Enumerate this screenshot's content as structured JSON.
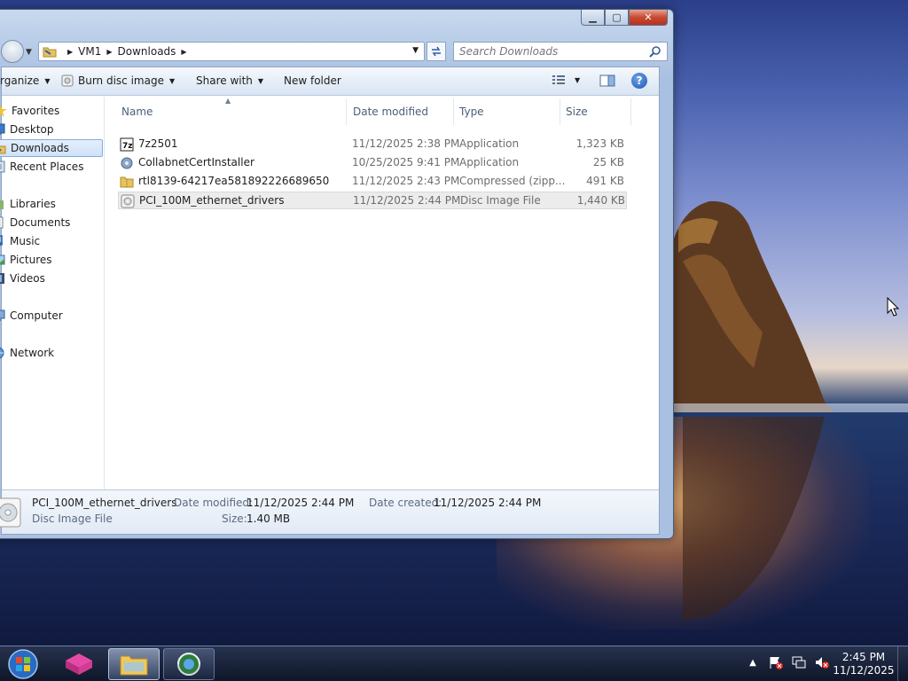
{
  "window": {
    "caption_buttons": {
      "minimize": "▁",
      "maximize": "▢",
      "close": "✕"
    }
  },
  "address_bar": {
    "crumbs": [
      "VM1",
      "Downloads"
    ],
    "search_placeholder": "Search Downloads"
  },
  "toolbar": {
    "organize": "rganize",
    "burn": "Burn disc image",
    "share": "Share with",
    "new_folder": "New folder"
  },
  "nav_pane": {
    "favorites": "Favorites",
    "desktop": "Desktop",
    "downloads": "Downloads",
    "recent": "Recent Places",
    "libraries": "Libraries",
    "documents": "Documents",
    "music": "Music",
    "pictures": "Pictures",
    "videos": "Videos",
    "computer": "Computer",
    "network": "Network"
  },
  "columns": {
    "name": "Name",
    "date": "Date modified",
    "type": "Type",
    "size": "Size"
  },
  "files": [
    {
      "name": "7z2501",
      "date": "11/12/2025 2:38 PM",
      "type": "Application",
      "size": "1,323 KB",
      "icon": "7zip-icon"
    },
    {
      "name": "CollabnetCertInstaller",
      "date": "10/25/2025 9:41 PM",
      "type": "Application",
      "size": "25 KB",
      "icon": "installer-icon"
    },
    {
      "name": "rtl8139-64217ea581892226689650",
      "date": "11/12/2025 2:43 PM",
      "type": "Compressed (zipp...",
      "size": "491 KB",
      "icon": "zip-folder-icon"
    },
    {
      "name": "PCI_100M_ethernet_drivers",
      "date": "11/12/2025 2:44 PM",
      "type": "Disc Image File",
      "size": "1,440 KB",
      "icon": "disc-image-icon"
    }
  ],
  "details": {
    "name": "PCI_100M_ethernet_drivers",
    "type": "Disc Image File",
    "date_modified_label": "Date modified:",
    "date_modified": "11/12/2025 2:44 PM",
    "size_label": "Size:",
    "size": "1.40 MB",
    "date_created_label": "Date created:",
    "date_created": "11/12/2025 2:44 PM"
  },
  "taskbar": {
    "time": "2:45 PM",
    "date": "11/12/2025",
    "tray_up": "▲"
  }
}
